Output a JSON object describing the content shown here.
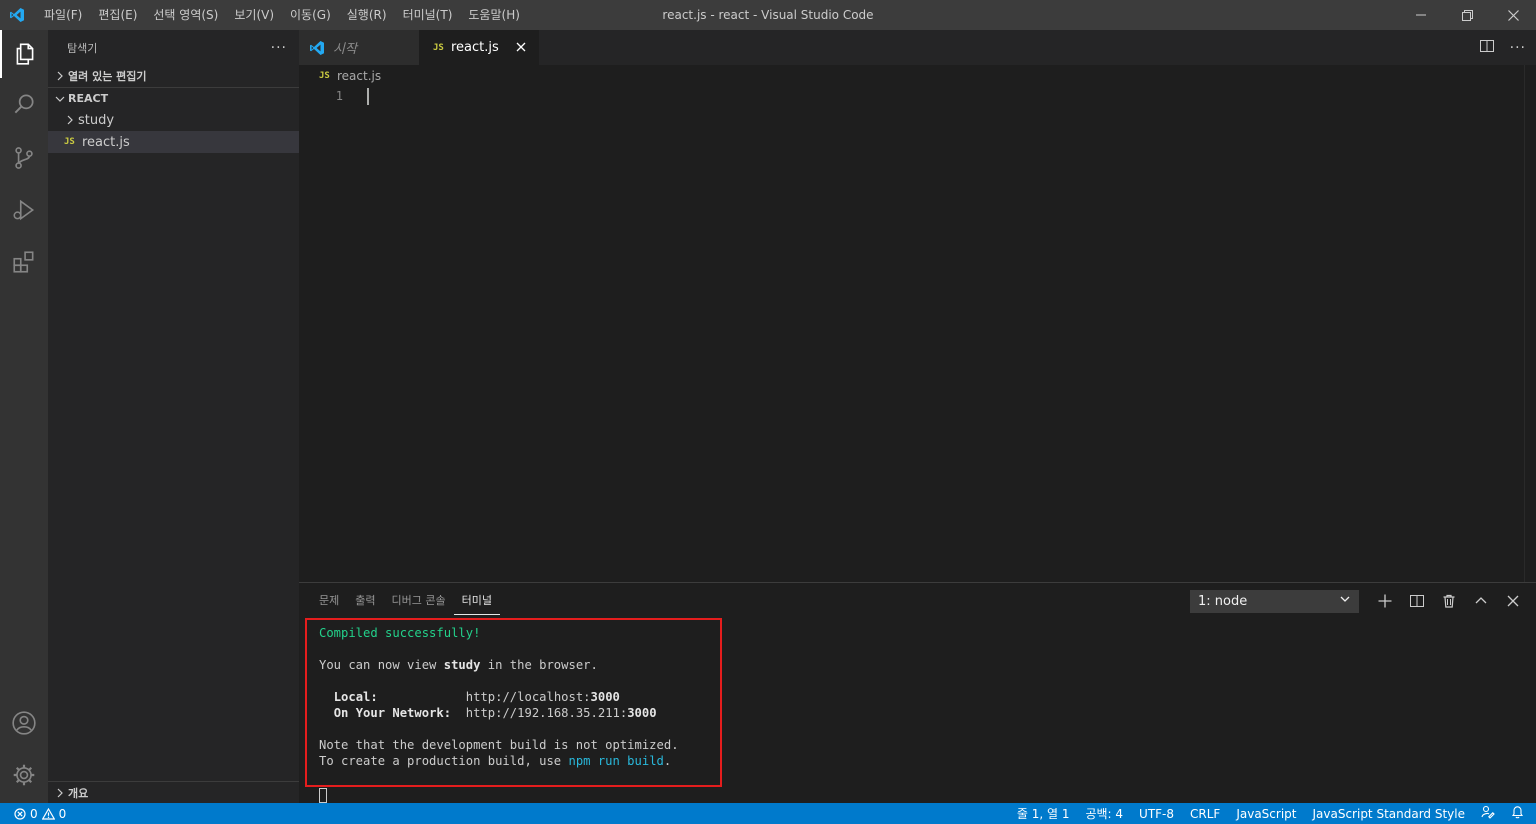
{
  "window": {
    "title": "react.js - react - Visual Studio Code"
  },
  "menu": [
    "파일(F)",
    "편집(E)",
    "선택 영역(S)",
    "보기(V)",
    "이동(G)",
    "실행(R)",
    "터미널(T)",
    "도움말(H)"
  ],
  "sidebar": {
    "title": "탐색기",
    "more": "···",
    "open_editors": "열려 있는 편집기",
    "workspace": "REACT",
    "tree": [
      {
        "label": "study",
        "type": "folder"
      },
      {
        "label": "react.js",
        "type": "file",
        "badge": "JS"
      }
    ],
    "outline": "개요"
  },
  "tabs": [
    {
      "label": "시작",
      "active": false
    },
    {
      "label": "react.js",
      "active": true,
      "badge": "JS"
    }
  ],
  "breadcrumb": {
    "badge": "JS",
    "file": "react.js"
  },
  "editor": {
    "line_number": "1"
  },
  "panel": {
    "tabs": [
      "문제",
      "출력",
      "디버그 콘솔",
      "터미널"
    ],
    "active_tab": "터미널",
    "terminal_select": "1: node"
  },
  "terminal": {
    "compiled": "Compiled successfully!",
    "view_prefix": "You can now view ",
    "app_name": "study",
    "view_suffix": " in the browser.",
    "local_label": "Local:",
    "local_url_prefix": "http://localhost:",
    "local_port": "3000",
    "network_label": "On Your Network:",
    "network_url_prefix": "http://192.168.35.211:",
    "network_port": "3000",
    "note1": "Note that the development build is not optimized.",
    "note2_prefix": "To create a production build, use ",
    "note2_cmd": "npm run build",
    "note2_suffix": "."
  },
  "statusbar": {
    "errors": "0",
    "warnings": "0",
    "position": "줄 1, 열 1",
    "spaces": "공백: 4",
    "encoding": "UTF-8",
    "eol": "CRLF",
    "language": "JavaScript",
    "linter": "JavaScript Standard Style"
  },
  "colors": {
    "accent": "#007acc",
    "highlight_border": "#e51d1d",
    "success_text": "#23d18b",
    "command_text": "#29b8db",
    "js_badge": "#cbcb41"
  }
}
